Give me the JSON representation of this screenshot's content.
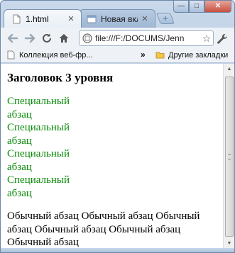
{
  "tabs": [
    {
      "label": "1.html",
      "active": true
    },
    {
      "label": "Новая вкла",
      "active": false
    }
  ],
  "window_controls": {
    "minimize": "—",
    "maximize": "□",
    "close": "✕"
  },
  "toolbar": {
    "url": "file:///F:/DOCUMS/Jenn",
    "star": "☆"
  },
  "bookmarks": {
    "item1": "Коллекция веб-фр...",
    "overflow": "»",
    "other": "Другие закладки"
  },
  "page": {
    "heading": "Заголовок 3 уровня",
    "special_paragraphs": [
      "Специальный абзац",
      "Специальный абзац",
      "Специальный абзац",
      "Специальный абзац"
    ],
    "normal_paragraph": "Обычный абзац Обычный абзац Обычный абзац Обычный абзац Обычный абзац Обычный абзац"
  },
  "colors": {
    "special_text": "#0b8a0b",
    "frame": "#a9c1dc"
  }
}
